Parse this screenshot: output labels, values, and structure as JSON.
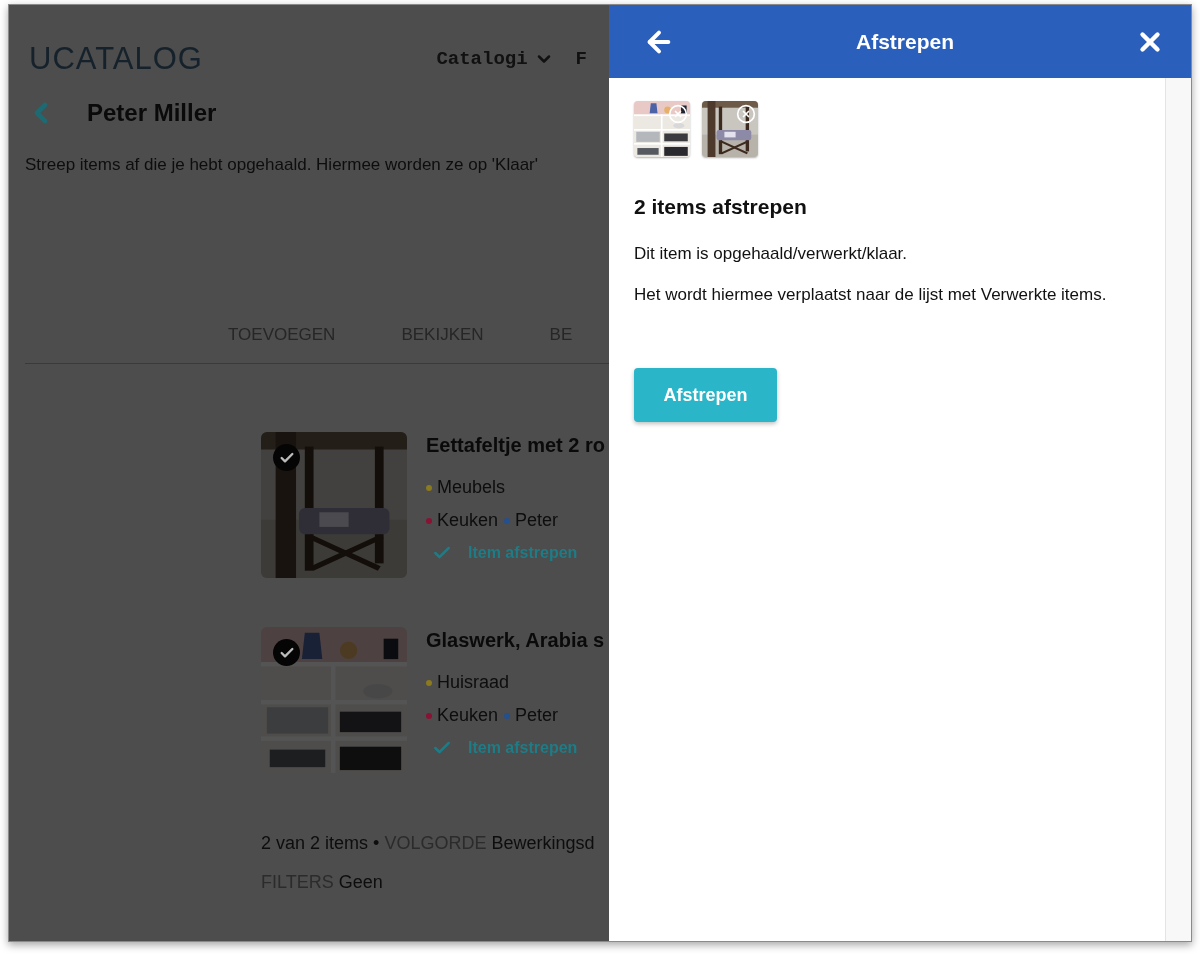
{
  "header": {
    "logo": "UCATALOG",
    "nav": [
      {
        "label": "Catalogi",
        "dropdown": true
      },
      {
        "label": "F",
        "dropdown": false
      }
    ]
  },
  "page": {
    "title": "Peter Miller",
    "description": "Streep items af die je hebt opgehaald. Hiermee worden ze op 'Klaar'",
    "tabs": [
      {
        "label": "TOEVOEGEN",
        "selected": false
      },
      {
        "label": "BEKIJKEN",
        "selected": false
      },
      {
        "label": "BE",
        "selected": false
      }
    ],
    "items": [
      {
        "title": "Eettafeltje met 2 ro",
        "checked": true,
        "tag_rows": [
          [
            {
              "label": "Meubels",
              "color": "#8c7a1e"
            }
          ],
          [
            {
              "label": "Keuken",
              "color": "#8a1234"
            },
            {
              "label": "Peter",
              "color": "#23508f"
            }
          ]
        ],
        "action": "Item afstrepen"
      },
      {
        "title": "Glaswerk, Arabia s",
        "checked": true,
        "tag_rows": [
          [
            {
              "label": "Huisraad",
              "color": "#8c7a1e"
            }
          ],
          [
            {
              "label": "Keuken",
              "color": "#8a1234"
            },
            {
              "label": "Peter",
              "color": "#23508f"
            }
          ]
        ],
        "action": "Item afstrepen"
      }
    ],
    "footer": {
      "count": "2 van 2 items",
      "separator": "•",
      "sort_label": "VOLGORDE",
      "sort_value": "Bewerkingsd",
      "filters_label": "FILTERS",
      "filters_value": "Geen"
    }
  },
  "panel": {
    "title": "Afstrepen",
    "thumbnails": [
      {
        "kind": "picture"
      },
      {
        "kind": "picture"
      }
    ],
    "heading": "2 items afstrepen",
    "paragraphs": [
      "Dit item is opgehaald/verwerkt/klaar.",
      "Het wordt hiermee verplaatst naar de lijst met Verwerkte items."
    ],
    "button": "Afstrepen"
  }
}
